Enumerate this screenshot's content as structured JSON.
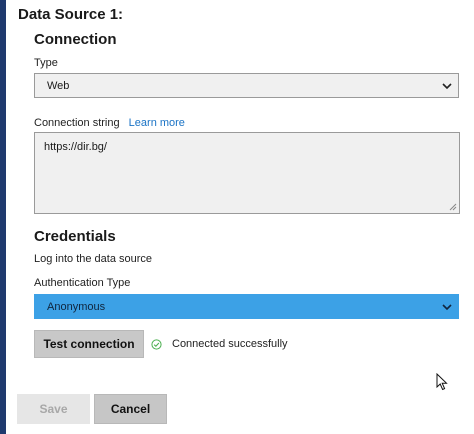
{
  "data_source": {
    "title": "Data Source 1:"
  },
  "connection": {
    "heading": "Connection",
    "type_label": "Type",
    "type_value": "Web",
    "connection_string_label": "Connection string",
    "learn_more_label": "Learn more",
    "connection_string_value": "https://dir.bg/"
  },
  "credentials": {
    "heading": "Credentials",
    "description": "Log into the data source",
    "auth_type_label": "Authentication Type",
    "auth_type_value": "Anonymous"
  },
  "test": {
    "button_label": "Test connection",
    "status_text": "Connected successfully",
    "status_color": "#4caf50"
  },
  "footer": {
    "save_label": "Save",
    "cancel_label": "Cancel"
  },
  "icons": {
    "type_dropdown": "chevron-down-icon",
    "auth_dropdown": "chevron-down-icon",
    "status": "check-circle-icon",
    "textarea_grip": "resize-grip-icon",
    "cursor": "mouse-pointer-icon"
  },
  "colors": {
    "accent_bar": "#1f3a6e",
    "selected_dropdown": "#3ca1e6",
    "link": "#1a73c5",
    "field_bg": "#f0f0f0"
  }
}
